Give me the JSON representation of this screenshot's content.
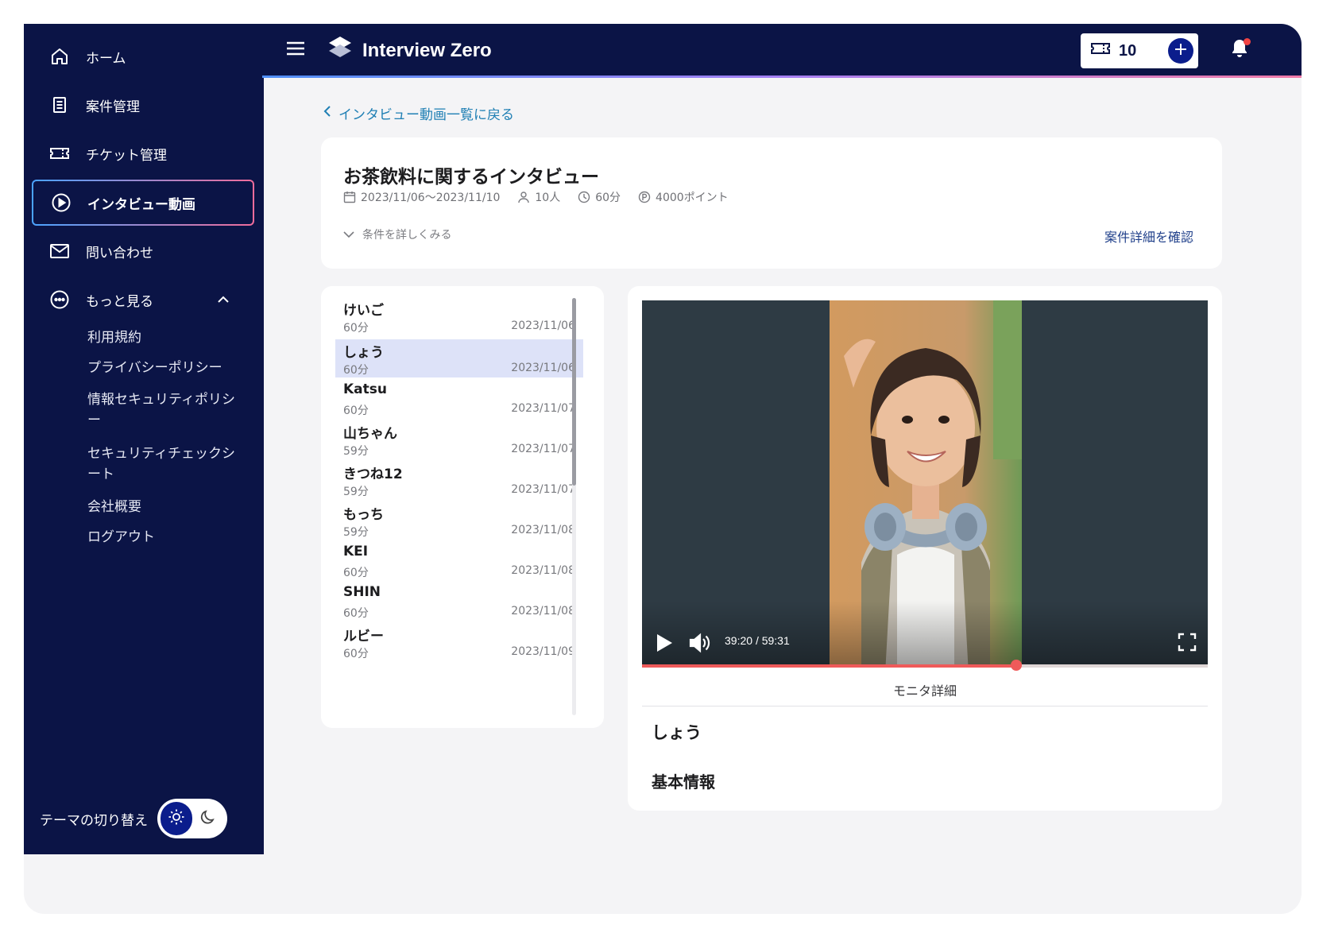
{
  "app": {
    "brand": "Interview Zero"
  },
  "header": {
    "ticket_count": "10"
  },
  "sidebar": {
    "items": [
      {
        "label": "ホーム",
        "icon": "home-icon"
      },
      {
        "label": "案件管理",
        "icon": "document-icon"
      },
      {
        "label": "チケット管理",
        "icon": "ticket-icon"
      },
      {
        "label": "インタビュー動画",
        "icon": "play-circle-icon",
        "active": true
      },
      {
        "label": "問い合わせ",
        "icon": "mail-icon"
      },
      {
        "label": "もっと見る",
        "icon": "more-circle-icon",
        "expanded": true
      }
    ],
    "sub_items": [
      {
        "label": "利用規約"
      },
      {
        "label": "プライバシーポリシー"
      },
      {
        "label": "情報セキュリティポリシー"
      },
      {
        "label": "セキュリティチェックシート"
      },
      {
        "label": "会社概要"
      },
      {
        "label": "ログアウト"
      }
    ],
    "theme_label": "テーマの切り替え"
  },
  "main": {
    "back_link": "インタビュー動画一覧に戻る",
    "project": {
      "title": "お茶飲料に関するインタビュー",
      "period": "2023/11/06〜2023/11/10",
      "people": "10人",
      "duration": "60分",
      "points": "4000ポイント",
      "conditions_toggle": "条件を詳しくみる",
      "detail_link": "案件詳細を確認"
    },
    "interviews": [
      {
        "name": "けいご",
        "duration": "60分",
        "date": "2023/11/06"
      },
      {
        "name": "しょう",
        "duration": "60分",
        "date": "2023/11/06",
        "selected": true
      },
      {
        "name": "Katsu",
        "duration": "60分",
        "date": "2023/11/07"
      },
      {
        "name": "山ちゃん",
        "duration": "59分",
        "date": "2023/11/07"
      },
      {
        "name": "きつね12",
        "duration": "59分",
        "date": "2023/11/07"
      },
      {
        "name": "もっち",
        "duration": "59分",
        "date": "2023/11/08"
      },
      {
        "name": "KEI",
        "duration": "60分",
        "date": "2023/11/08"
      },
      {
        "name": "SHIN",
        "duration": "60分",
        "date": "2023/11/08"
      },
      {
        "name": "ルビー",
        "duration": "60分",
        "date": "2023/11/09"
      }
    ],
    "player": {
      "current_time": "39:20",
      "separator": "/",
      "total_time": "59:31",
      "progress_fraction": 0.661
    },
    "monitor": {
      "section_label": "モニタ詳細",
      "name": "しょう",
      "basic_info_heading": "基本情報"
    }
  },
  "colors": {
    "navy": "#0b1446",
    "accent_blue": "#0b1d8c",
    "link_blue": "#1f7fb4",
    "progress_red": "#ef5a5a",
    "selected_row": "#dde2f8"
  }
}
